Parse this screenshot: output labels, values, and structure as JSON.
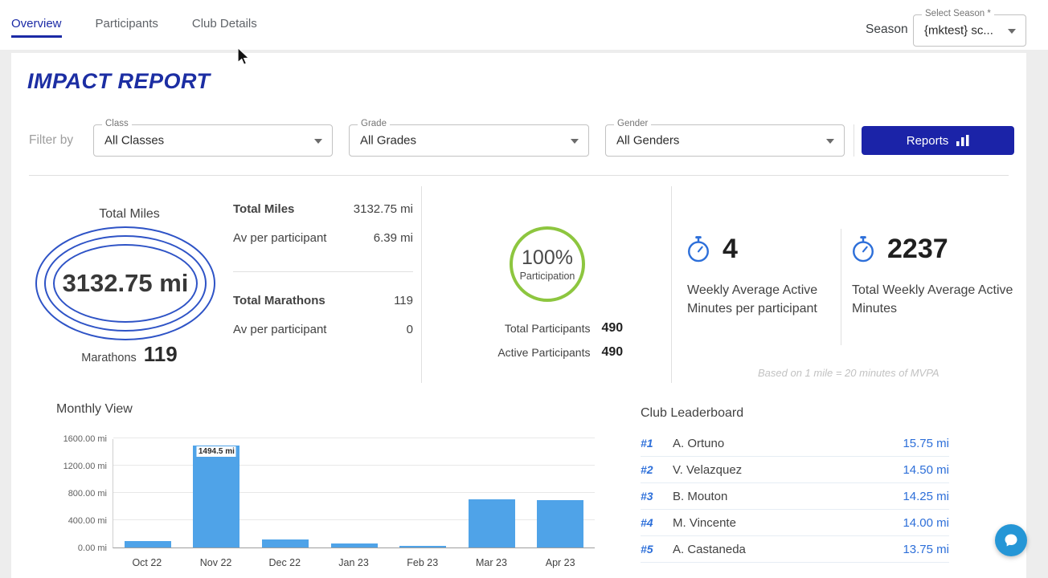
{
  "topbar": {
    "tabs": [
      {
        "label": "Overview"
      },
      {
        "label": "Participants"
      },
      {
        "label": "Club Details"
      }
    ],
    "season_text": "Season",
    "season_select": {
      "label": "Select Season *",
      "value": "{mktest} sc..."
    }
  },
  "page": {
    "title": "IMPACT REPORT"
  },
  "filters": {
    "filter_by": "Filter by",
    "class": {
      "label": "Class",
      "value": "All Classes"
    },
    "grade": {
      "label": "Grade",
      "value": "All Grades"
    },
    "gender": {
      "label": "Gender",
      "value": "All Genders"
    },
    "reports_button": "Reports"
  },
  "stats": {
    "miles_card": {
      "title": "Total Miles",
      "value": "3132.75 mi",
      "marathons_label": "Marathons",
      "marathons_value": "119"
    },
    "summary": {
      "total_miles_label": "Total Miles",
      "total_miles_value": "3132.75 mi",
      "avg_miles_label": "Av per participant",
      "avg_miles_value": "6.39 mi",
      "total_marathons_label": "Total Marathons",
      "total_marathons_value": "119",
      "avg_marathons_label": "Av per participant",
      "avg_marathons_value": "0"
    },
    "participation": {
      "percent": "100%",
      "label": "Participation",
      "total_label": "Total Participants",
      "total_value": "490",
      "active_label": "Active Participants",
      "active_value": "490"
    },
    "weekly_avg": {
      "value": "4",
      "label": "Weekly Average Active Minutes per participant"
    },
    "weekly_total": {
      "value": "2237",
      "label": "Total Weekly Average Active Minutes"
    },
    "footnote": "Based on 1 mile = 20 minutes of MVPA"
  },
  "chart_data": {
    "type": "bar",
    "title": "Monthly View",
    "categories": [
      "Oct 22",
      "Nov 22",
      "Dec 22",
      "Jan 23",
      "Feb 23",
      "Mar 23",
      "Apr 23"
    ],
    "values": [
      95,
      1494.5,
      115,
      55,
      20,
      700,
      695
    ],
    "labeled_bar": {
      "index": 1,
      "label": "1494.5 mi"
    },
    "y_ticks": [
      "0.00 mi",
      "400.00 mi",
      "800.00 mi",
      "1200.00 mi",
      "1600.00 mi"
    ],
    "ylim": [
      0,
      1600
    ],
    "unit": "mi",
    "bar_color": "#4FA3E8",
    "grid": true,
    "legend": false
  },
  "leaderboard": {
    "title": "Club Leaderboard",
    "rows": [
      {
        "rank": "#1",
        "name": "A. Ortuno",
        "value": "15.75 mi"
      },
      {
        "rank": "#2",
        "name": "V. Velazquez",
        "value": "14.50 mi"
      },
      {
        "rank": "#3",
        "name": "B. Mouton",
        "value": "14.25 mi"
      },
      {
        "rank": "#4",
        "name": "M. Vincente",
        "value": "14.00 mi"
      },
      {
        "rank": "#5",
        "name": "A. Castaneda",
        "value": "13.75 mi"
      }
    ]
  },
  "colors": {
    "brand_blue": "#1B2AA6",
    "link_blue": "#2D6FD9",
    "bar_blue": "#4FA3E8",
    "green": "#8DC63F"
  }
}
